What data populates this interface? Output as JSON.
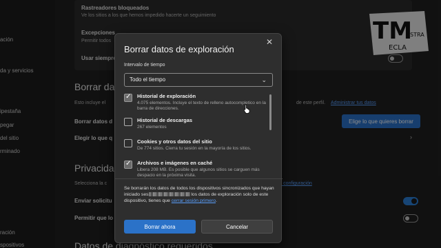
{
  "sidebar": {
    "items": [
      "ación",
      "da y servicios",
      "",
      "ipestaña",
      "pegar",
      "del sitio",
      "rminado",
      "ración",
      "spositivos"
    ]
  },
  "main": {
    "tracker_card": {
      "title": "Rastreadores bloqueados",
      "desc": "Ve los sitios a los que hemos impedido hacerte un seguimiento",
      "exceptions_title": "Excepciones",
      "exceptions_desc": "Permitir todos",
      "strict_label": "Usar siempre"
    },
    "clear_heading": "Borrar dat",
    "clear_desc": "Esto incluye el",
    "clear_desc_right": "de este perfil.",
    "clear_link": "Administrar tus datos",
    "clear_now_label": "Borrar datos d",
    "choose_label": "Elegir lo que q",
    "choose_button": "Elige lo que quieres borrar",
    "privacy_heading": "Privacidad",
    "privacy_desc": "Selecciona la c",
    "privacy_link": "obre esta configuración",
    "send_label": "Enviar solicitu",
    "allow_label": "Permitir que lo",
    "diag_heading": "Datos de diagnóstico requeridos"
  },
  "dialog": {
    "title": "Borrar datos de exploración",
    "time_label": "Intervalo de tiempo",
    "time_value": "Todo el tiempo",
    "items": [
      {
        "title": "Historial de exploración",
        "desc": "4.075 elementos. Incluye el texto de relleno autocompletico en la barra de direcciones.",
        "checked": true
      },
      {
        "title": "Historial de descargas",
        "desc": "267 elementos",
        "checked": false
      },
      {
        "title": "Cookies y otros datos del sitio",
        "desc": "De 774 sitios. Cierra tu sesión en la mayoría de los sitios.",
        "checked": false
      },
      {
        "title": "Archivos e imágenes en caché",
        "desc": "Libera 208 MB. Es posible que algunos sitios se carguen más despacio en la próxima visita.",
        "checked": true
      }
    ],
    "note_a": "Se borrarán los datos de todos los dispositivos sincronizados que hayan iniciado ses",
    "note_b": "los datos de exploración solo de este dispositivo, tienes que",
    "note_link": "cerrar sesión primero",
    "note_end": ".",
    "primary_button": "Borrar ahora",
    "secondary_button": "Cancelar"
  },
  "watermark": {
    "big": "TM",
    "small_a": "ESTRA",
    "small_b": "ECLA"
  },
  "colors": {
    "accent": "#2b72c8",
    "link": "#5aa0ff",
    "dialog_bg": "#2e2e2e"
  }
}
